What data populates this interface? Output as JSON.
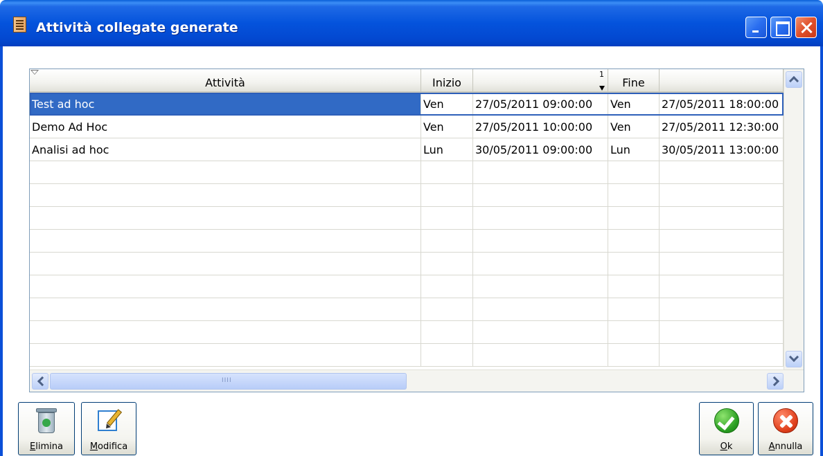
{
  "window": {
    "title": "Attività collegate generate"
  },
  "grid": {
    "columns": [
      {
        "label": "Attività"
      },
      {
        "label": "Inizio"
      },
      {
        "label": "",
        "sort_index": "1"
      },
      {
        "label": "Fine"
      },
      {
        "label": ""
      }
    ],
    "rows": [
      {
        "attivita": "Test ad hoc",
        "inizio_giorno": "Ven",
        "inizio_data": "27/05/2011 09:00:00",
        "fine_giorno": "Ven",
        "fine_data": "27/05/2011 18:00:00",
        "selected": true
      },
      {
        "attivita": "Demo Ad Hoc",
        "inizio_giorno": "Ven",
        "inizio_data": "27/05/2011 10:00:00",
        "fine_giorno": "Ven",
        "fine_data": "27/05/2011 12:30:00",
        "selected": false
      },
      {
        "attivita": "Analisi ad hoc",
        "inizio_giorno": "Lun",
        "inizio_data": "30/05/2011 09:00:00",
        "fine_giorno": "Lun",
        "fine_data": "30/05/2011 13:00:00",
        "selected": false
      }
    ],
    "empty_rows": 9
  },
  "buttons": {
    "elimina": "Elimina",
    "modifica": "Modifica",
    "ok": "Ok",
    "annulla": "Annulla"
  },
  "icons": {
    "app": "document-icon",
    "elimina": "recycle-bin-icon",
    "modifica": "edit-icon",
    "ok": "checkmark-icon",
    "annulla": "cancel-icon"
  },
  "colors": {
    "titlebar": "#0453dc",
    "selection": "#316ac5"
  }
}
